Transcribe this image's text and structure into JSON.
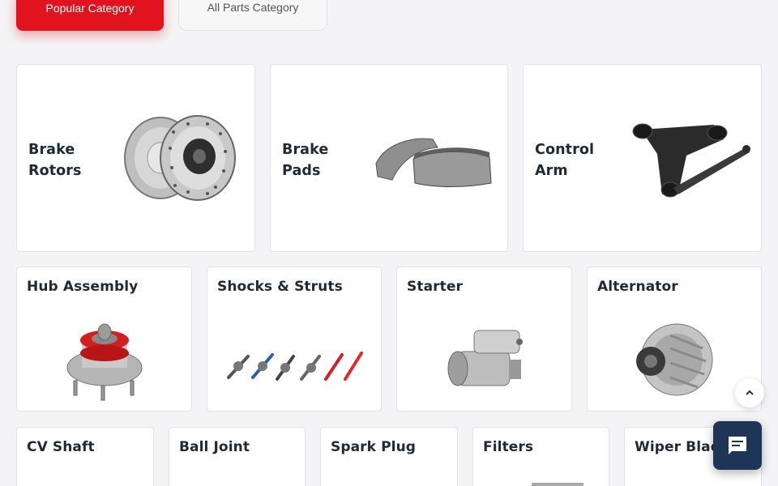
{
  "tabs": {
    "popular": "Popular Category",
    "all_parts": "All Parts Category"
  },
  "row1": [
    {
      "line1": "Brake",
      "line2": "Rotors",
      "icon": "brake-rotors-image"
    },
    {
      "line1": "Brake",
      "line2": "Pads",
      "icon": "brake-pads-image"
    },
    {
      "line1": "Control",
      "line2": "Arm",
      "icon": "control-arm-image"
    }
  ],
  "row2": [
    {
      "label": "Hub Assembly",
      "icon": "hub-assembly-image"
    },
    {
      "label": "Shocks & Struts",
      "icon": "shocks-struts-image"
    },
    {
      "label": "Starter",
      "icon": "starter-image"
    },
    {
      "label": "Alternator",
      "icon": "alternator-image"
    }
  ],
  "row3": [
    {
      "label": "CV Shaft"
    },
    {
      "label": "Ball Joint"
    },
    {
      "label": "Spark Plug"
    },
    {
      "label": "Filters"
    },
    {
      "label": "Wiper Blades"
    }
  ],
  "widgets": {
    "scroll_top_icon": "chevron-up-icon",
    "chat_icon": "chat-icon"
  },
  "colors": {
    "accent": "#e0131f",
    "title": "#1e2a38",
    "chat_bg": "#1f3558"
  }
}
